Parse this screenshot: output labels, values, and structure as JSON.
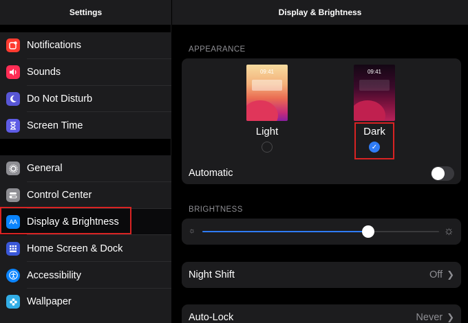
{
  "sidebar": {
    "title": "Settings",
    "group1": [
      {
        "label": "Notifications",
        "icon": "notifications-icon",
        "glyph": "●",
        "color": "#ff3b30"
      },
      {
        "label": "Sounds",
        "icon": "speaker-icon",
        "glyph": "◀",
        "color": "#ff2d55"
      },
      {
        "label": "Do Not Disturb",
        "icon": "moon-icon",
        "glyph": "☾",
        "color": "#5856d6"
      },
      {
        "label": "Screen Time",
        "icon": "hourglass-icon",
        "glyph": "⧗",
        "color": "#5e5ce6"
      }
    ],
    "group2": [
      {
        "label": "General",
        "icon": "gear-icon",
        "glyph": "⚙",
        "color": "#8e8e93"
      },
      {
        "label": "Control Center",
        "icon": "toggles-icon",
        "glyph": "◐",
        "color": "#8e8e93"
      },
      {
        "label": "Display & Brightness",
        "icon": "display-icon",
        "glyph": "AA",
        "color": "#0a84ff"
      },
      {
        "label": "Home Screen & Dock",
        "icon": "grid-icon",
        "glyph": "▦",
        "color": "#3a57d8"
      },
      {
        "label": "Accessibility",
        "icon": "accessibility-icon",
        "glyph": "✪",
        "color": "#0a84ff"
      },
      {
        "label": "Wallpaper",
        "icon": "flower-icon",
        "glyph": "✿",
        "color": "#32ade6"
      }
    ]
  },
  "main": {
    "title": "Display & Brightness",
    "appearance": {
      "section_title": "APPEARANCE",
      "light_label": "Light",
      "dark_label": "Dark",
      "time": "09:41",
      "selected": "Dark",
      "automatic_label": "Automatic",
      "automatic_on": false
    },
    "brightness": {
      "section_title": "BRIGHTNESS",
      "level": 0.7
    },
    "night_shift": {
      "label": "Night Shift",
      "value": "Off"
    },
    "auto_lock": {
      "label": "Auto-Lock",
      "value": "Never"
    }
  },
  "colors": {
    "accent": "#2f7cf6",
    "highlight": "#d92323"
  }
}
